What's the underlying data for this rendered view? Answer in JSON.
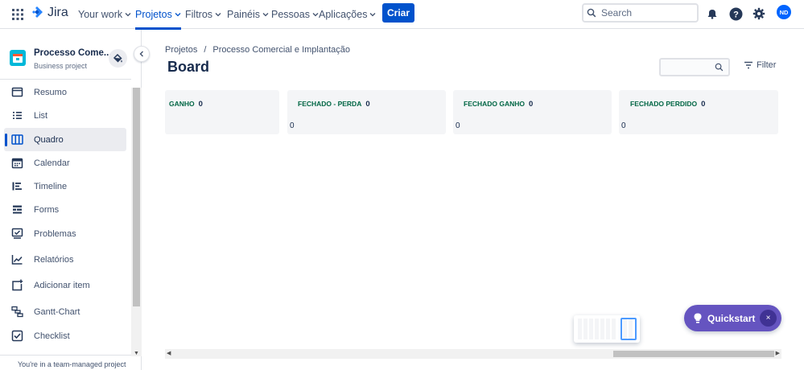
{
  "topnav": {
    "logo_text": "Jira",
    "items": [
      {
        "label": "Your work",
        "has_chevron": true
      },
      {
        "label": "Projetos",
        "has_chevron": true,
        "active": true
      },
      {
        "label": "Filtros",
        "has_chevron": true
      },
      {
        "label": "Painéis",
        "has_chevron": true
      },
      {
        "label": "Pessoas",
        "has_chevron": true
      },
      {
        "label": "Aplicações",
        "has_chevron": true
      }
    ],
    "create_label": "Criar",
    "search_placeholder": "Search",
    "avatar_initials": "ND",
    "colors": {
      "brand": "#0052cc",
      "avatar": "#0065ff"
    }
  },
  "sidebar": {
    "project_name": "Processo Come...",
    "project_type": "Business project",
    "items": [
      {
        "label": "Resumo",
        "icon": "summary-icon"
      },
      {
        "label": "List",
        "icon": "list-icon"
      },
      {
        "label": "Quadro",
        "icon": "board-icon",
        "selected": true
      },
      {
        "label": "Calendar",
        "icon": "calendar-icon"
      },
      {
        "label": "Timeline",
        "icon": "timeline-icon"
      },
      {
        "label": "Forms",
        "icon": "forms-icon"
      },
      {
        "label": "Problemas",
        "icon": "issues-icon"
      },
      {
        "label": "Relatórios",
        "icon": "reports-icon"
      },
      {
        "label": "Adicionar item",
        "icon": "add-item-icon"
      },
      {
        "label": "Gantt-Chart",
        "icon": "gantt-icon"
      },
      {
        "label": "Checklist",
        "icon": "checklist-icon"
      }
    ],
    "team_note": "You're in a team-managed project"
  },
  "main": {
    "breadcrumb": [
      "Projetos",
      "/",
      "Processo Comercial e Implantação"
    ],
    "title": "Board",
    "filter_label": "Filter",
    "columns": [
      {
        "title": "GANHO",
        "count": "0",
        "total": ""
      },
      {
        "title": "FECHADO - PERDA",
        "count": "0",
        "total": "0"
      },
      {
        "title": "FECHADO GANHO",
        "count": "0",
        "total": "0"
      },
      {
        "title": "FECHADO PERDIDO",
        "count": "0",
        "total": "0"
      }
    ]
  },
  "quickstart": {
    "label": "Quickstart",
    "close": "×",
    "color": "#6554c0"
  }
}
